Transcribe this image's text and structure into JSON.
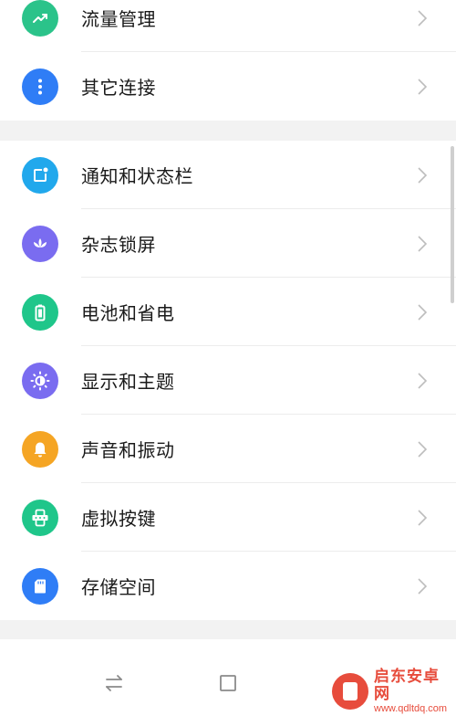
{
  "group1": {
    "items": [
      {
        "label": "流量管理",
        "icon": "trend-chart-icon",
        "color": "#2bc38a"
      },
      {
        "label": "其它连接",
        "icon": "more-dots-icon",
        "color": "#2f7df6"
      }
    ]
  },
  "group2": {
    "items": [
      {
        "label": "通知和状态栏",
        "icon": "notification-icon",
        "color": "#21a8ec"
      },
      {
        "label": "杂志锁屏",
        "icon": "lotus-icon",
        "color": "#7a6cf0"
      },
      {
        "label": "电池和省电",
        "icon": "battery-icon",
        "color": "#1fc68a"
      },
      {
        "label": "显示和主题",
        "icon": "brightness-icon",
        "color": "#7a6cf0"
      },
      {
        "label": "声音和振动",
        "icon": "bell-icon",
        "color": "#f5a524"
      },
      {
        "label": "虚拟按键",
        "icon": "virtual-keys-icon",
        "color": "#1fc68a"
      },
      {
        "label": "存储空间",
        "icon": "sd-card-icon",
        "color": "#2f7df6"
      }
    ]
  },
  "navbar": {
    "buttons": [
      "switch-icon",
      "square-icon",
      "back-icon"
    ]
  },
  "watermark": {
    "name": "启东安卓网",
    "url": "www.qdltdq.com"
  }
}
